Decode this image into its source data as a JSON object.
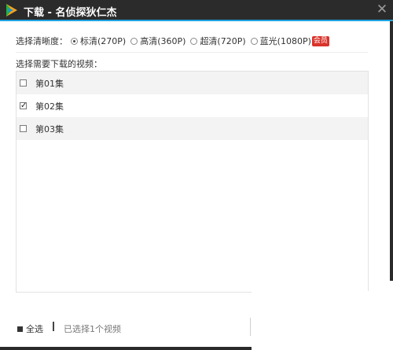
{
  "window": {
    "title": "下载 - 名侦探狄仁杰",
    "close_label": "✕",
    "logo_icon": "tencent-video-logo-icon",
    "title_bar_color": "#2b2b2b",
    "accent_color": "#1fa3e0"
  },
  "definition": {
    "label": "选择清晰度：",
    "options": [
      {
        "label": "标清(270P)",
        "selected": true
      },
      {
        "label": "高清(360P)",
        "selected": false
      },
      {
        "label": "超清(720P)",
        "selected": false
      },
      {
        "label": "蓝光(1080P)",
        "selected": false
      }
    ],
    "vip_badge": "会员",
    "vip_color": "#d9332b"
  },
  "list": {
    "label": "选择需要下载的视频：",
    "items": [
      {
        "label": "第01集",
        "checked": false
      },
      {
        "label": "第02集",
        "checked": true
      },
      {
        "label": "第03集",
        "checked": false
      }
    ]
  },
  "footer": {
    "select_all_label": "全选",
    "selected_count_text": "已选择1个视频"
  }
}
